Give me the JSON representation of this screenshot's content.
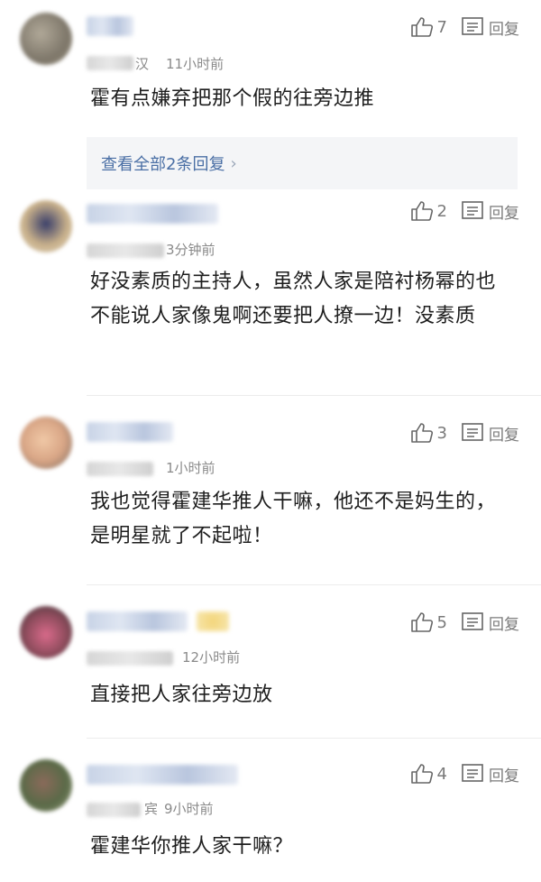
{
  "comments": [
    {
      "time": "11小时前",
      "time_prefix": "汉",
      "likes": "7",
      "reply_label": "回复",
      "text": "霍有点嫌弃把那个假的往旁边推",
      "view_replies": "查看全部2条回复"
    },
    {
      "time": "3分钟前",
      "time_prefix": "",
      "likes": "2",
      "reply_label": "回复",
      "text": "好没素质的主持人，虽然人家是陪衬杨幂的也不能说人家像鬼啊还要把人撩一边！没素质"
    },
    {
      "time": "1小时前",
      "time_prefix": "",
      "likes": "3",
      "reply_label": "回复",
      "text": "我也觉得霍建华推人干嘛，他还不是妈生的，是明星就了不起啦！"
    },
    {
      "time": "12小时前",
      "time_prefix": "",
      "likes": "5",
      "reply_label": "回复",
      "text": "直接把人家往旁边放"
    },
    {
      "time": "9小时前",
      "time_prefix": "宾",
      "likes": "4",
      "reply_label": "回复",
      "text": "霍建华你推人家干嘛？"
    }
  ],
  "colors": {
    "link": "#4a6fa5",
    "muted": "#8a8a8a",
    "reply_bg": "#f4f5f7"
  }
}
